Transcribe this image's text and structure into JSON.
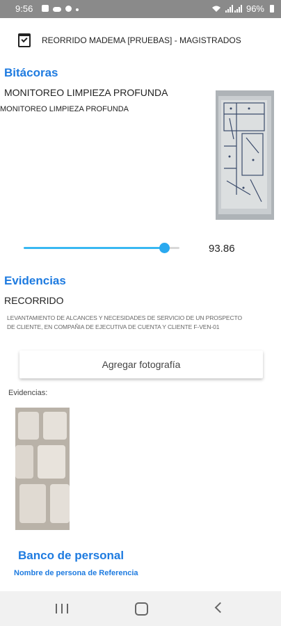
{
  "status_bar": {
    "time": "9:56",
    "battery": "96%",
    "icons": [
      "image-icon",
      "cloud-icon",
      "settings-icon",
      "dot-icon",
      "wifi-icon",
      "signal-icon",
      "battery-icon"
    ]
  },
  "header": {
    "title": "REORRIDO MADEMA [PRUEBAS] - MAGISTRADOS",
    "icon": "calendar-check-icon"
  },
  "bitacoras": {
    "title": "Bitácoras",
    "item_title": "MONITOREO LIMPIEZA PROFUNDA",
    "item_subtitle": "MONITOREO LIMPIEZA PROFUNDA",
    "thumbnail": "floor-plan-photo",
    "slider_value": "93.86",
    "slider_fraction": 0.9
  },
  "evidencias": {
    "title": "Evidencias",
    "item_title": "RECORRIDO",
    "description_line1": "LEVANTAMIENTO DE  ALCANCES Y NECESIDADES DE SERVICIO DE UN PROSPECTO",
    "description_line2": "DE CLIENTE, EN COMPAÑIA  DE EJECUTIVA DE CUENTA  Y CLIENTE  F-VEN-01",
    "add_photo_label": "Agregar fotografía",
    "list_label": "Evidencias:",
    "photo": "keyboard-photo"
  },
  "banco": {
    "title": "Banco de personal",
    "subtitle": "Nombre de persona de Referencia"
  },
  "colors": {
    "accent": "#1e7be0",
    "slider": "#2aa9ef",
    "status_bar": "#8a8a8a"
  }
}
